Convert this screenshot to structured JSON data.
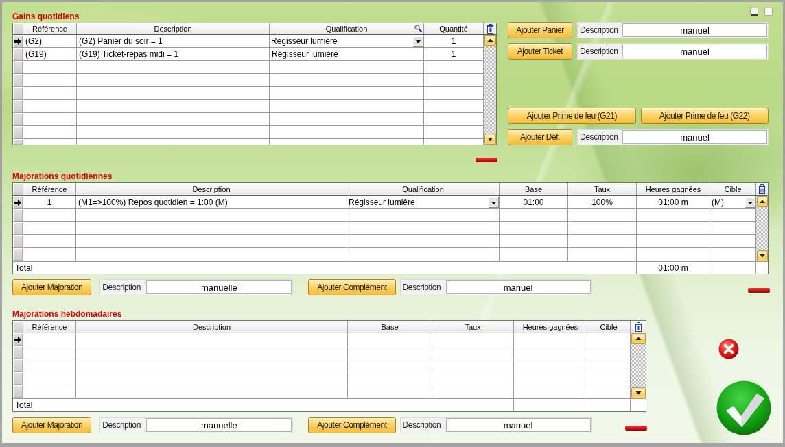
{
  "gains_quotidiens": {
    "title": "Gains quotidiens",
    "table": {
      "columns": [
        {
          "label": "Référence",
          "kind": "text",
          "searchable": false
        },
        {
          "label": "Description",
          "kind": "text",
          "searchable": false
        },
        {
          "label": "Qualification",
          "kind": "choice",
          "searchable": true
        },
        {
          "label": "Quantité",
          "kind": "number",
          "searchable": false
        }
      ],
      "rows": [
        {
          "selected": true,
          "cells": [
            "(G2)",
            "(G2) Panier du soir = 1",
            "Régisseur lumière",
            "1"
          ]
        },
        {
          "selected": false,
          "cells": [
            "(G19)",
            "(G19) Ticket-repas midi = 1",
            "Régisseur lumière",
            "1"
          ]
        }
      ],
      "new_row_selected": false
    },
    "actions": [
      {
        "kind": "field",
        "button": "Ajouter Panier",
        "label": "Description",
        "value": "manuel"
      },
      {
        "kind": "field",
        "button": "Ajouter Ticket",
        "label": "Description",
        "value": "manuel"
      },
      {
        "kind": "buttons",
        "buttons": [
          "Ajouter Prime de feu (G21)",
          "Ajouter Prime de feu (G22)"
        ]
      },
      {
        "kind": "field",
        "button": "Ajouter Déf.",
        "label": "Description",
        "value": "manuel"
      }
    ]
  },
  "majorations_quotidiennes": {
    "title": "Majorations quotidiennes",
    "table": {
      "columns": [
        {
          "label": "Référence",
          "kind": "number"
        },
        {
          "label": "Description",
          "kind": "text"
        },
        {
          "label": "Qualification",
          "kind": "choice"
        },
        {
          "label": "Base",
          "kind": "number"
        },
        {
          "label": "Taux",
          "kind": "number"
        },
        {
          "label": "Heures gagnées",
          "kind": "number"
        },
        {
          "label": "Cible",
          "kind": "choice"
        }
      ],
      "rows": [
        {
          "selected": true,
          "cells": [
            "1",
            "(M1=>100%) Repos quotidien = 1:00 (M)",
            "Régisseur lumière",
            "01:00",
            "100%",
            "01:00 m",
            "(M)"
          ]
        }
      ],
      "new_row_selected": false,
      "total": {
        "label": "Total",
        "hours": "01:00 m"
      }
    },
    "actions": [
      {
        "kind": "field",
        "button": "Ajouter Majoration",
        "label": "Description",
        "value": "manuelle"
      },
      {
        "kind": "field",
        "button": "Ajouter Complément",
        "label": "Description",
        "value": "manuel"
      }
    ]
  },
  "majorations_hebdomadaires": {
    "title": "Majorations hebdomadaires",
    "table": {
      "columns": [
        {
          "label": "Référence"
        },
        {
          "label": "Description"
        },
        {
          "label": "Base"
        },
        {
          "label": "Taux"
        },
        {
          "label": "Heures gagnées"
        },
        {
          "label": "Cible"
        }
      ],
      "new_row_selected": true,
      "total": {
        "label": "Total"
      }
    },
    "actions": [
      {
        "kind": "field",
        "button": "Ajouter Majoration",
        "label": "Description",
        "value": "manuelle"
      },
      {
        "kind": "field",
        "button": "Ajouter Complément",
        "label": "Description",
        "value": "manuel"
      }
    ]
  }
}
